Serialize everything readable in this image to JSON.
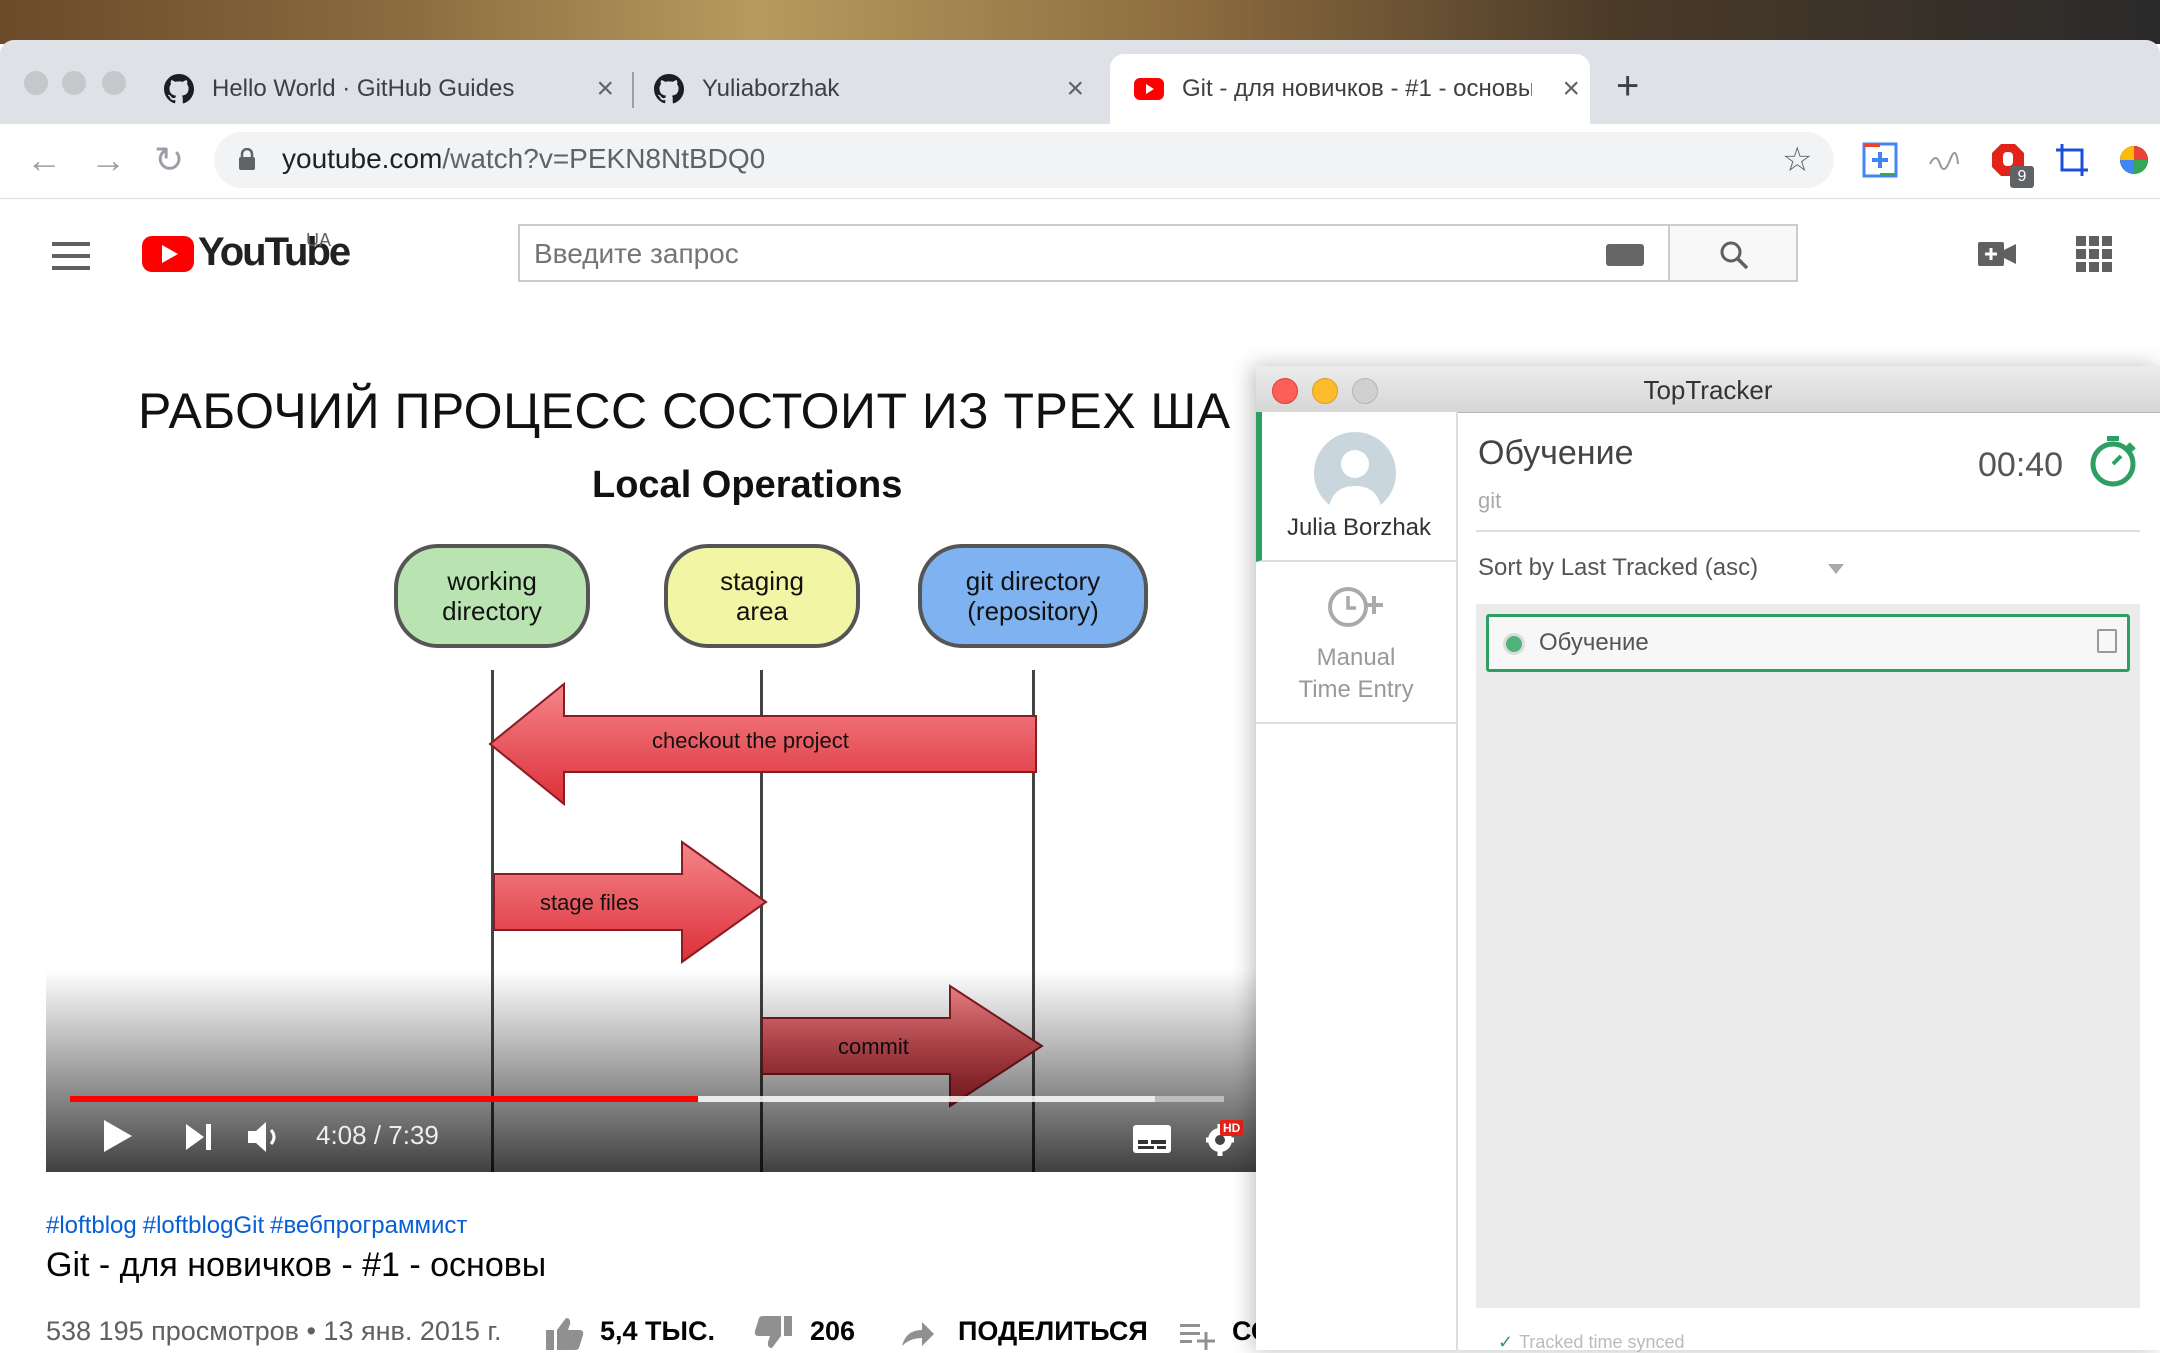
{
  "browser": {
    "tabs": [
      {
        "title": "Hello World · GitHub Guides",
        "icon": "github-icon"
      },
      {
        "title": "Yuliaborzhak",
        "icon": "github-icon"
      },
      {
        "title": "Git - для новичков - #1 - основы",
        "icon": "youtube-icon",
        "active": true
      }
    ],
    "new_tab": "+",
    "url_host": "youtube.com",
    "url_path": "/watch?v=PEKN8NtBDQ0",
    "extension_badge": "9"
  },
  "youtube": {
    "logo_text": "YouTube",
    "region": "UA",
    "search_placeholder": "Введите запрос"
  },
  "video": {
    "slide_title": "РАБОЧИЙ ПРОЦЕСС СОСТОИТ ИЗ ТРЕХ ША",
    "diagram_title": "Local Operations",
    "nodes": [
      {
        "line1": "working",
        "line2": "directory",
        "color": "#b9e3b1"
      },
      {
        "line1": "staging",
        "line2": "area",
        "color": "#f2f5a4"
      },
      {
        "line1": "git directory",
        "line2": "(repository)",
        "color": "#7fb2f0"
      }
    ],
    "arrows": [
      "checkout the project",
      "stage files",
      "commit"
    ],
    "time": "4:08 / 7:39",
    "progress": 0.544,
    "buffered": 0.94,
    "hd_badge": "HD"
  },
  "meta": {
    "hashtags": [
      "#loftblog",
      "#loftblogGit",
      "#вебпрограммист"
    ],
    "title": "Git - для новичков - #1 - основы",
    "views": "538 195 просмотров • 13 янв. 2015 г.",
    "likes": "5,4 ТЫС.",
    "dislikes": "206",
    "share": "ПОДЕЛИТЬСЯ",
    "save_partial": "СО"
  },
  "toptracker": {
    "window_title": "TopTracker",
    "user_name": "Julia Borzhak",
    "manual_line1": "Manual",
    "manual_line2": "Time Entry",
    "project_title": "Обучение",
    "project_sub": "git",
    "timer": "00:40",
    "sort_label": "Sort by Last Tracked (asc)",
    "task_name": "Обучение",
    "synced": "Tracked time synced",
    "accent": "#2e9e63"
  }
}
